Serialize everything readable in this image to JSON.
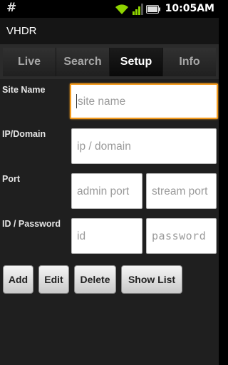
{
  "status_bar": {
    "notification_glyph": "#",
    "time": "10:05AM",
    "icons": [
      "wifi-icon",
      "signal-icon",
      "battery-icon"
    ]
  },
  "app": {
    "title": "VHDR"
  },
  "tabs": [
    {
      "label": "Live",
      "active": false
    },
    {
      "label": "Search",
      "active": false
    },
    {
      "label": "Setup",
      "active": true
    },
    {
      "label": "Info",
      "active": false
    }
  ],
  "form": {
    "site_name": {
      "label": "Site Name",
      "placeholder": "site name"
    },
    "ip_domain": {
      "label": "IP/Domain",
      "placeholder": "ip / domain"
    },
    "port": {
      "label": "Port",
      "admin_placeholder": "admin port",
      "stream_placeholder": "stream port"
    },
    "credentials": {
      "label": "ID / Password",
      "id_placeholder": "id",
      "password_placeholder": "password"
    }
  },
  "buttons": {
    "add": "Add",
    "edit": "Edit",
    "delete": "Delete",
    "show_list": "Show List"
  },
  "colors": {
    "focus_border": "#f29a1d",
    "background": "#1f1f1f",
    "active_tab_text": "#ffffff",
    "inactive_tab_text": "#a7a7a7"
  }
}
